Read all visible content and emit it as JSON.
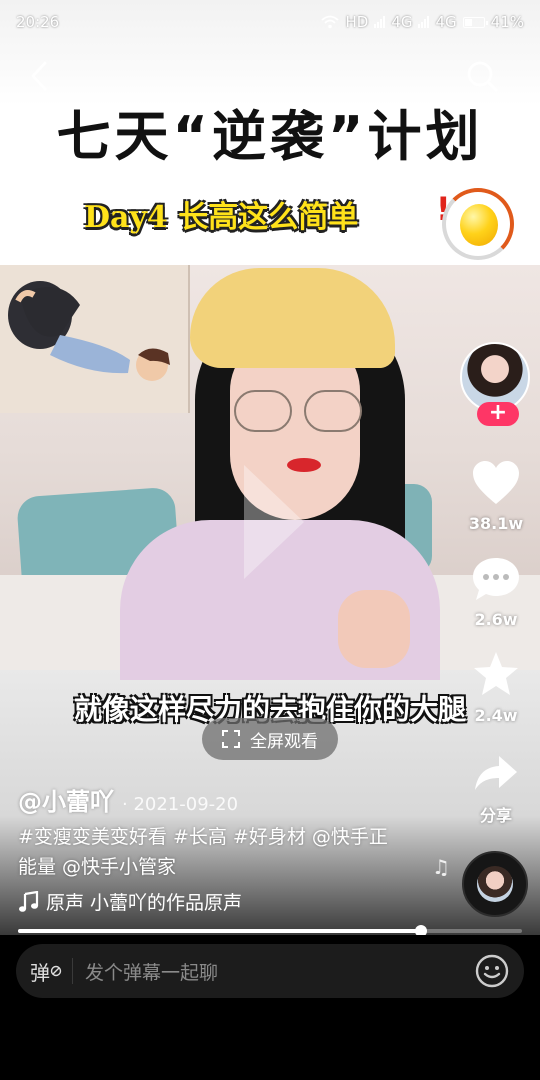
{
  "status_bar": {
    "time": "20:26",
    "network_1": "HD",
    "network_2": "4G",
    "network_3": "4G",
    "battery": "41%",
    "battery_level": 0.41
  },
  "video": {
    "title_main": "七天“逆袭”计划",
    "title_sub": "Day4 长高这么简单",
    "title_exclaim": "!",
    "caption": "就像这样尽力的去抱住你的大腿",
    "fullscreen_label": "全屏观看"
  },
  "rail": {
    "follow_label": "+",
    "likes": "38.1w",
    "comments": "2.6w",
    "favorites": "2.4w",
    "share_label": "分享"
  },
  "info": {
    "author": "@小蕾吖",
    "date": "· 2021-09-20",
    "description": "#变瘦变美变好看 #长高 #好身材 @快手正能量 @快手小管家",
    "sound": "原声   小蕾吖的作品原声"
  },
  "progress": {
    "fraction": 0.8
  },
  "bottom_bar": {
    "danmaku_toggle": "弹",
    "input_placeholder": "发个弹幕一起聊"
  },
  "colors": {
    "accent_pink": "#fe3666",
    "title_yellow": "#ffe21a",
    "title_red": "#e0241b"
  },
  "icons": [
    "back-icon",
    "search-icon",
    "heart-icon",
    "comment-icon",
    "star-icon",
    "share-icon",
    "music-note-icon",
    "fullscreen-icon",
    "emoji-icon"
  ]
}
